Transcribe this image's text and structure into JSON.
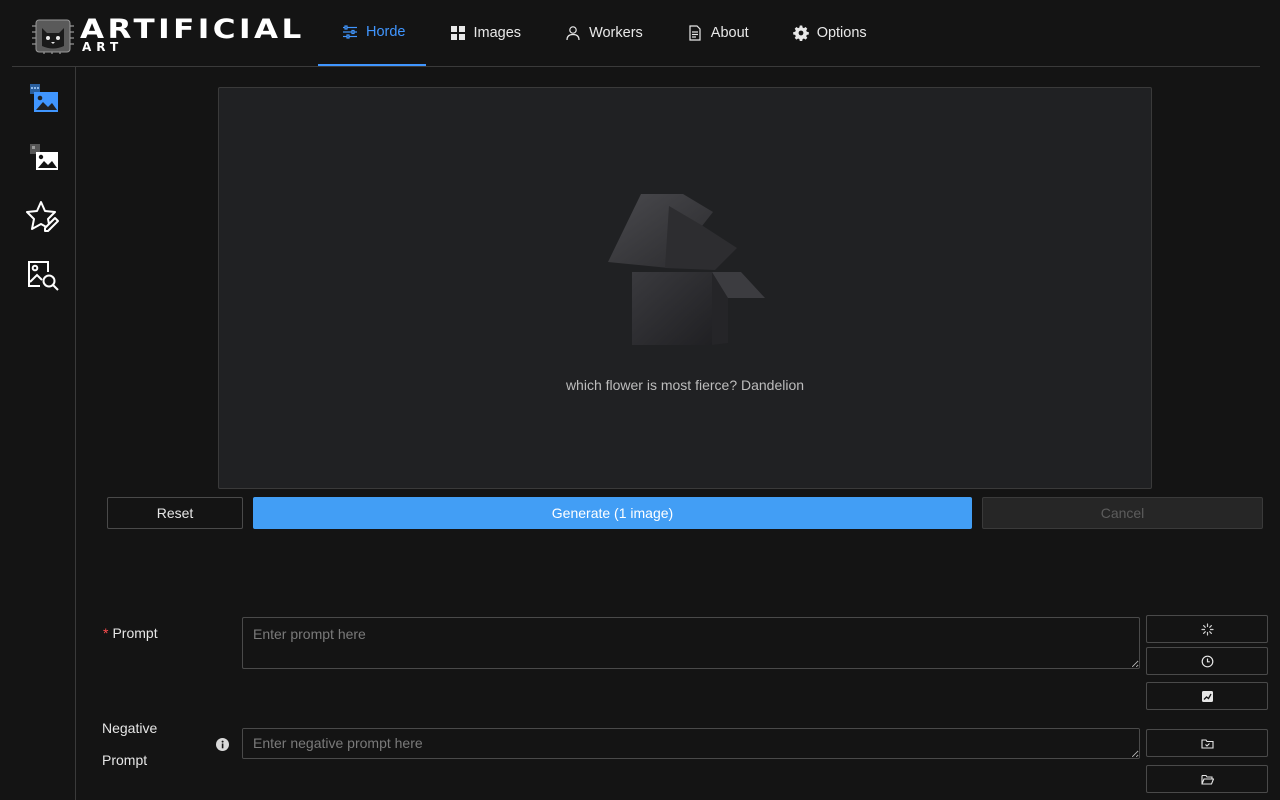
{
  "brand": {
    "title": "ARTIFICIAL",
    "subtitle": "ART"
  },
  "nav": [
    {
      "label": "Horde",
      "icon": "sliders-icon",
      "active": true
    },
    {
      "label": "Images",
      "icon": "grid-icon"
    },
    {
      "label": "Workers",
      "icon": "user-icon"
    },
    {
      "label": "About",
      "icon": "document-icon"
    },
    {
      "label": "Options",
      "icon": "gear-icon"
    }
  ],
  "sidebar": [
    {
      "icon": "text-to-image-icon",
      "active": true
    },
    {
      "icon": "image-to-image-icon"
    },
    {
      "icon": "star-pencil-icon"
    },
    {
      "icon": "image-search-icon"
    }
  ],
  "preview": {
    "message": "which flower is most fierce? Dandelion"
  },
  "actions": {
    "reset": "Reset",
    "generate": "Generate (1 image)",
    "cancel": "Cancel"
  },
  "form": {
    "prompt_label": "Prompt",
    "prompt_required_mark": "*",
    "prompt_placeholder": "Enter prompt here",
    "negative_label_line1": "Negative",
    "negative_label_line2": "Prompt",
    "negative_placeholder": "Enter negative prompt here"
  },
  "colors": {
    "accent": "#429ef5",
    "background": "#141414",
    "panel": "#202123",
    "required": "#ff4d4f"
  }
}
